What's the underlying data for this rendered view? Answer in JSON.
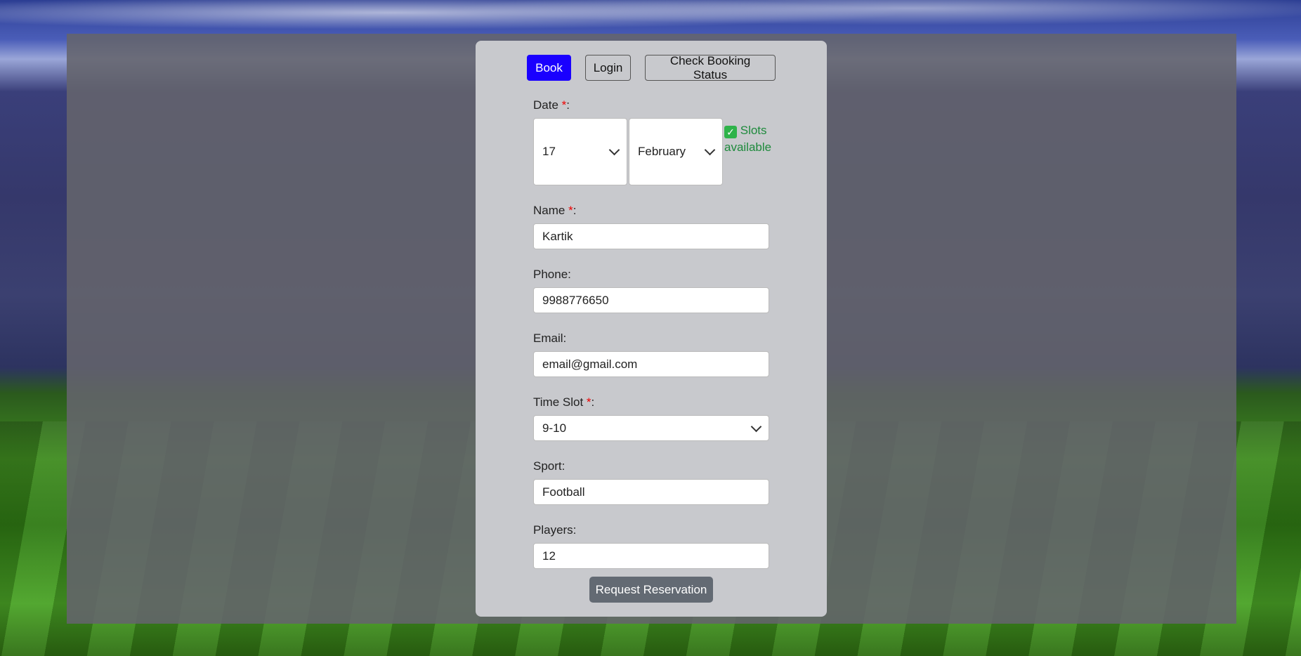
{
  "nav": {
    "book": "Book",
    "login": "Login",
    "check_status": "Check Booking Status",
    "active_color": "#1a00ff"
  },
  "form": {
    "date": {
      "label": "Date ",
      "required_mark": "*",
      "suffix": ":",
      "day": "17",
      "month": "February",
      "availability_icon": "check-mark-icon",
      "availability_glyph": "✓",
      "availability_text": "Slots available",
      "availability_color": "#1e8a3c"
    },
    "name": {
      "label": "Name ",
      "required_mark": "*",
      "suffix": ":",
      "value": "Kartik"
    },
    "phone": {
      "label": "Phone:",
      "value": "9988776650"
    },
    "email": {
      "label": "Email:",
      "value": "email@gmail.com"
    },
    "time_slot": {
      "label": "Time Slot ",
      "required_mark": "*",
      "suffix": ":",
      "value": "9-10"
    },
    "sport": {
      "label": "Sport:",
      "value": "Football"
    },
    "players": {
      "label": "Players:",
      "value": "12"
    },
    "submit_label": "Request Reservation"
  }
}
